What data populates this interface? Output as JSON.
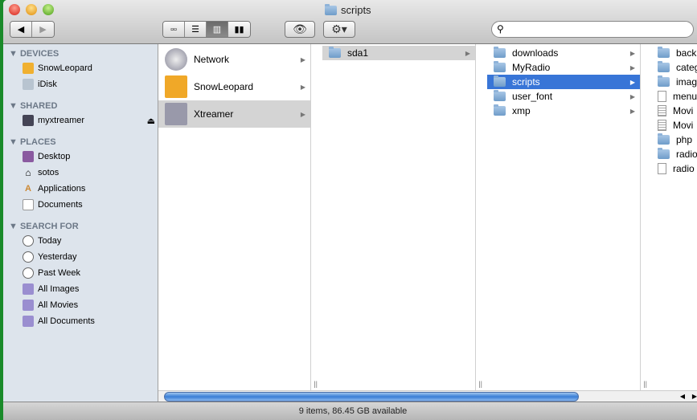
{
  "window": {
    "title": "scripts"
  },
  "toolbar": {
    "back": "◀",
    "forward": "▶",
    "views": [
      "icon-view",
      "list-view",
      "column-view",
      "coverflow-view"
    ],
    "active_view": "column-view",
    "search_placeholder": ""
  },
  "sidebar": {
    "sections": [
      {
        "title": "DEVICES",
        "items": [
          {
            "label": "SnowLeopard",
            "icon": "hard-drive-icon"
          },
          {
            "label": "iDisk",
            "icon": "idisk-icon"
          }
        ]
      },
      {
        "title": "SHARED",
        "items": [
          {
            "label": "myxtreamer",
            "icon": "network-computer-icon",
            "eject": true
          }
        ]
      },
      {
        "title": "PLACES",
        "items": [
          {
            "label": "Desktop",
            "icon": "desktop-icon"
          },
          {
            "label": "sotos",
            "icon": "home-icon"
          },
          {
            "label": "Applications",
            "icon": "applications-icon"
          },
          {
            "label": "Documents",
            "icon": "documents-icon"
          }
        ]
      },
      {
        "title": "SEARCH FOR",
        "items": [
          {
            "label": "Today",
            "icon": "clock-icon"
          },
          {
            "label": "Yesterday",
            "icon": "clock-icon"
          },
          {
            "label": "Past Week",
            "icon": "clock-icon"
          },
          {
            "label": "All Images",
            "icon": "smart-folder-icon"
          },
          {
            "label": "All Movies",
            "icon": "smart-folder-icon"
          },
          {
            "label": "All Documents",
            "icon": "smart-folder-icon"
          }
        ]
      }
    ]
  },
  "columns": [
    {
      "items": [
        {
          "label": "Network",
          "type": "network"
        },
        {
          "label": "SnowLeopard",
          "type": "drive"
        },
        {
          "label": "Xtreamer",
          "type": "server",
          "selected": "grey"
        }
      ]
    },
    {
      "items": [
        {
          "label": "sda1",
          "type": "folder",
          "selected": "grey"
        }
      ]
    },
    {
      "items": [
        {
          "label": "downloads",
          "type": "folder"
        },
        {
          "label": "MyRadio",
          "type": "folder"
        },
        {
          "label": "scripts",
          "type": "folder",
          "selected": "blue"
        },
        {
          "label": "user_font",
          "type": "folder"
        },
        {
          "label": "xmp",
          "type": "folder"
        }
      ]
    },
    {
      "items": [
        {
          "label": "back",
          "type": "folder"
        },
        {
          "label": "categ",
          "type": "folder"
        },
        {
          "label": "imag",
          "type": "folder"
        },
        {
          "label": "menu",
          "type": "file"
        },
        {
          "label": "Movi",
          "type": "text"
        },
        {
          "label": "Movi",
          "type": "text"
        },
        {
          "label": "php",
          "type": "folder"
        },
        {
          "label": "radio",
          "type": "folder"
        },
        {
          "label": "radio",
          "type": "file"
        }
      ]
    }
  ],
  "status": {
    "text": "9 items, 86.45 GB available"
  },
  "colors": {
    "selection": "#3875d7",
    "sidebar": "#dde4ec"
  }
}
